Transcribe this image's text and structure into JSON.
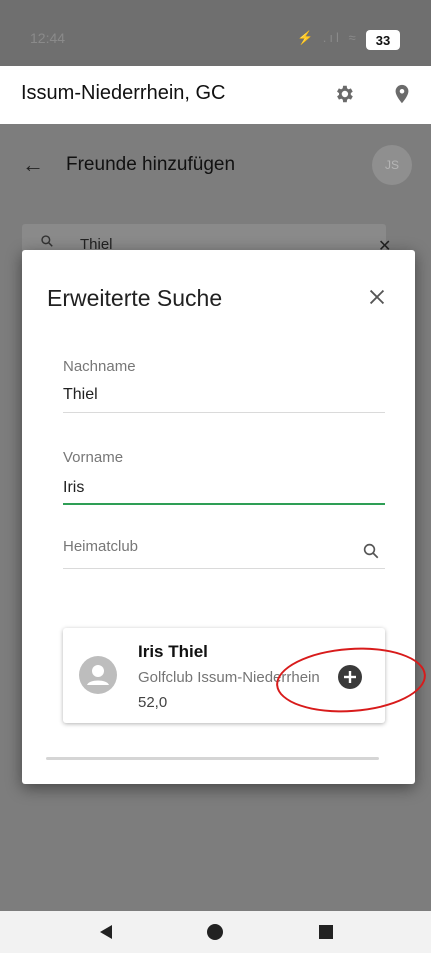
{
  "status_bar": {
    "time": "12:44",
    "icons": "⚡ .ıl ≈",
    "battery": "33"
  },
  "app_bar": {
    "title": "Issum-Niederrhein, GC",
    "icons": [
      "gear-icon",
      "location-pin-icon"
    ]
  },
  "page": {
    "title": "Freunde hinzufügen",
    "avatar_initials": "JS"
  },
  "search": {
    "value": "Thiel"
  },
  "dialog": {
    "title": "Erweiterte Suche",
    "fields": {
      "lastname": {
        "label": "Nachname",
        "value": "Thiel"
      },
      "firstname": {
        "label": "Vorname",
        "value": "Iris"
      },
      "homeclub": {
        "label": "Heimatclub",
        "value": ""
      }
    },
    "result": {
      "name": "Iris Thiel",
      "club": "Golfclub Issum-Niederrhein",
      "handicap": "52,0"
    }
  },
  "colors": {
    "accent": "#2e9e55",
    "highlight": "#d81b1b",
    "overlay": "#7d7d7d"
  }
}
